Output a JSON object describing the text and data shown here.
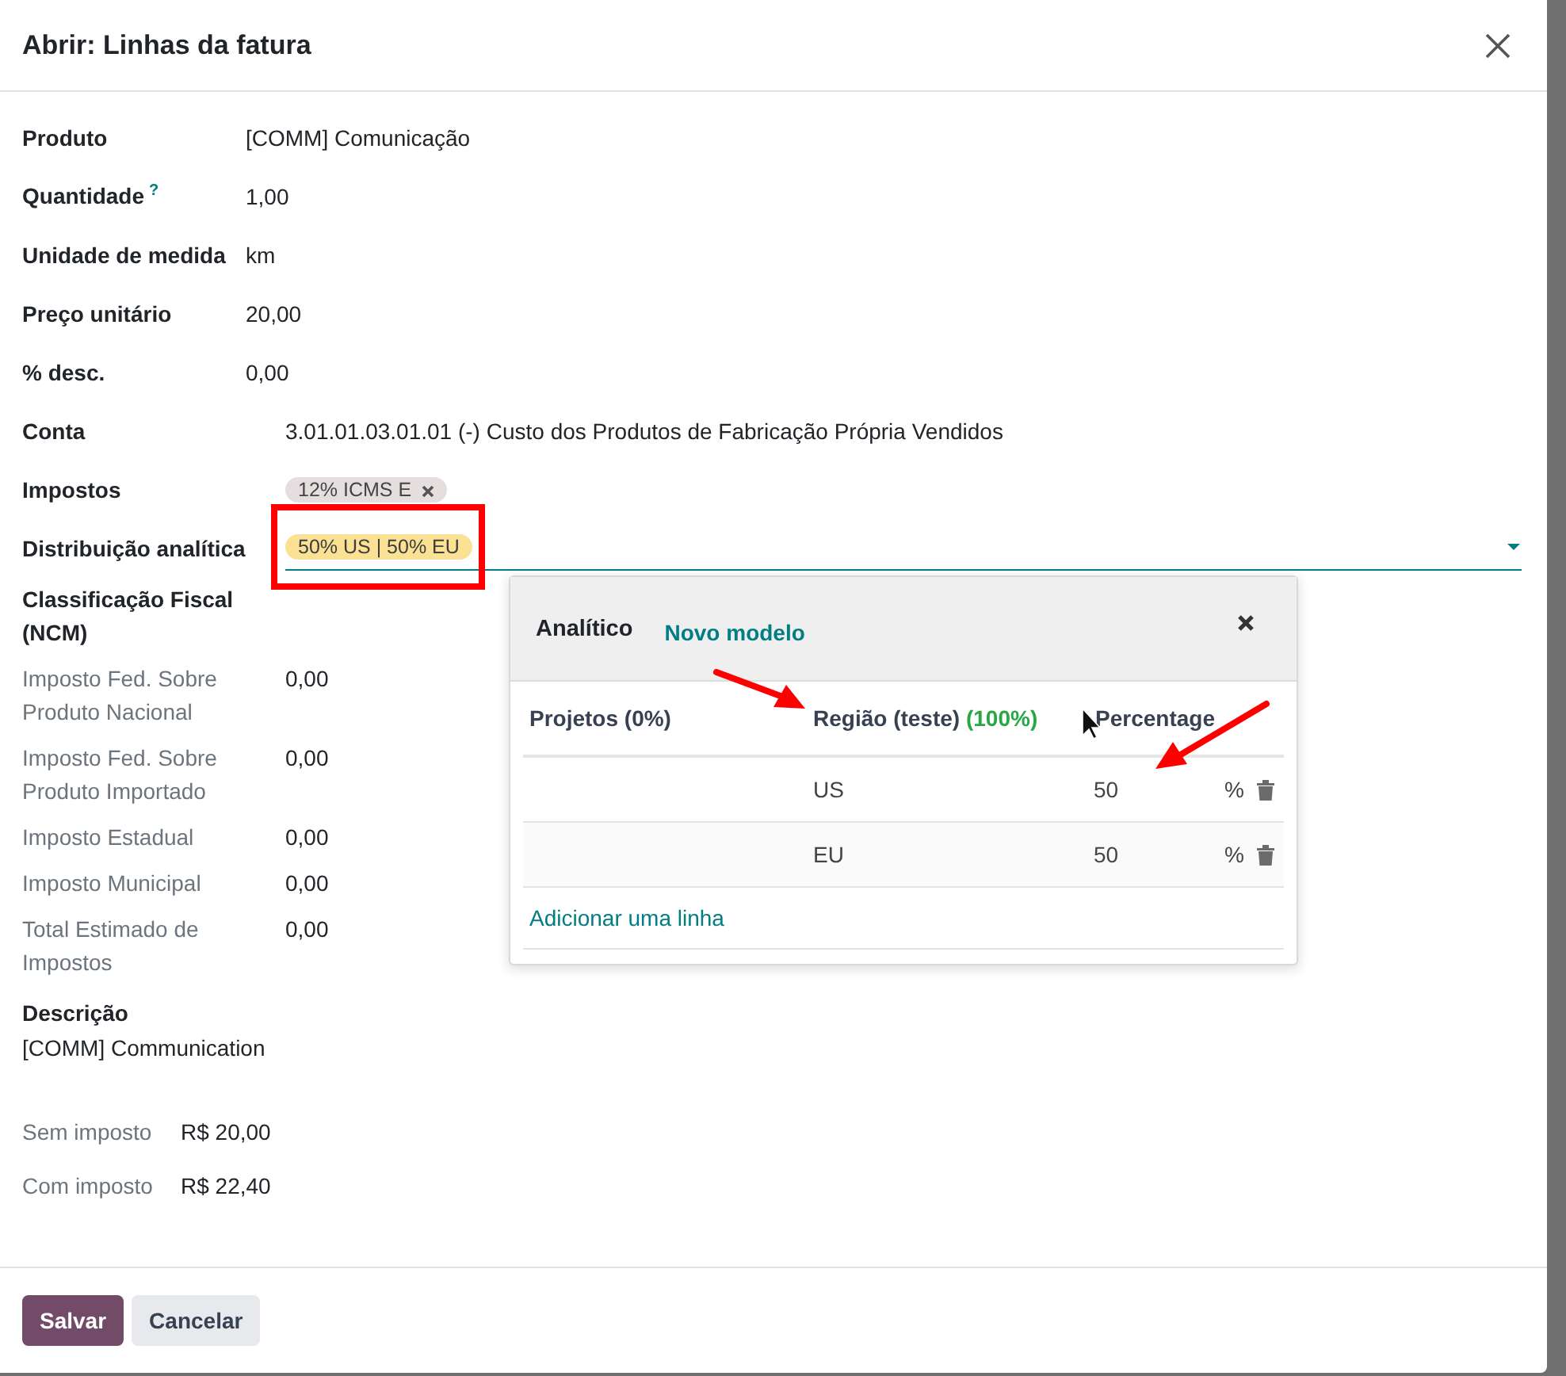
{
  "dialog": {
    "title": "Abrir: Linhas da fatura"
  },
  "fields": [
    {
      "kind": "text",
      "label": "Produto",
      "value": "[COMM] Comunicação"
    },
    {
      "kind": "text",
      "label": "Quantidade",
      "help": "?",
      "value": "1,00"
    },
    {
      "kind": "text",
      "label": "Unidade de medida",
      "value": "km"
    },
    {
      "kind": "text",
      "label": "Preço unitário",
      "value": "20,00"
    },
    {
      "kind": "text",
      "label": "% desc.",
      "value": "0,00"
    },
    {
      "kind": "relation",
      "label": "Conta",
      "value": "3.01.01.03.01.01 (-) Custo dos Produtos de Fabricação Própria Vendidos"
    },
    {
      "kind": "tags",
      "label": "Impostos",
      "tag": "12% ICMS E"
    },
    {
      "kind": "analytic",
      "label": "Distribuição analítica",
      "tag": "50% US | 50% EU"
    },
    {
      "kind": "section",
      "label": "Classificação Fiscal (NCM)"
    },
    {
      "kind": "muted",
      "label": "Imposto Fed. Sobre Produto Nacional",
      "value": "0,00"
    },
    {
      "kind": "muted",
      "label": "Imposto Fed. Sobre Produto Importado",
      "value": "0,00"
    },
    {
      "kind": "muted",
      "label": "Imposto Estadual",
      "value": "0,00"
    },
    {
      "kind": "muted",
      "label": "Imposto Municipal",
      "value": "0,00"
    },
    {
      "kind": "muted",
      "label": "Total Estimado de Impostos",
      "value": "0,00"
    },
    {
      "kind": "stacked",
      "label": "Descrição",
      "value": "[COMM] Communication"
    }
  ],
  "totals": [
    {
      "label": "Sem imposto",
      "value": "R$ 20,00"
    },
    {
      "label": "Com imposto",
      "value": "R$ 22,40"
    }
  ],
  "popover": {
    "title": "Analítico",
    "link": "Novo modelo",
    "columns": [
      {
        "label": "Projetos (0%)"
      },
      {
        "label": "Região (teste)",
        "share": "(100%)"
      },
      {
        "label": "Percentage"
      }
    ],
    "rows": [
      {
        "region": "US",
        "percentage": "50",
        "unit": "%"
      },
      {
        "region": "EU",
        "percentage": "50",
        "unit": "%"
      }
    ],
    "add_line": "Adicionar uma linha"
  },
  "buttons": [
    {
      "label": "Salvar",
      "kind": "primary"
    },
    {
      "label": "Cancelar",
      "kind": "secondary"
    }
  ]
}
